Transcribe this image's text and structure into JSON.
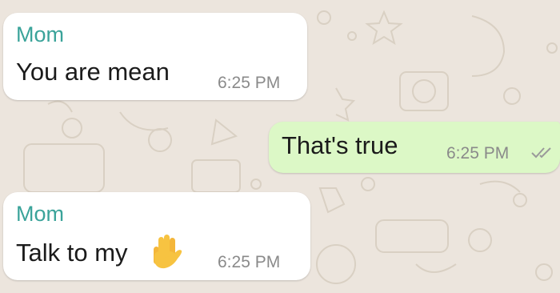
{
  "colors": {
    "background": "#ECE5DD",
    "incoming": "#FFFFFF",
    "outgoing": "#DCF8C6",
    "sender": "#3AA39A",
    "time": "#8A8A8A"
  },
  "messages": [
    {
      "direction": "incoming",
      "sender": "Mom",
      "text": "You are mean",
      "time": "6:25 PM"
    },
    {
      "direction": "outgoing",
      "text": "That's true",
      "time": "6:25 PM",
      "status_icon": "double-check-icon"
    },
    {
      "direction": "incoming",
      "sender": "Mom",
      "text": "Talk to my",
      "emoji": "raised-hand-icon",
      "time": "6:25 PM"
    }
  ]
}
